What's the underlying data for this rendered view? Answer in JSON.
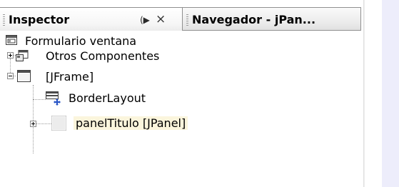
{
  "tabs": {
    "inspector": {
      "title": "Inspector",
      "minimize": "◀)",
      "close": "×"
    },
    "navegador": {
      "title": "Navegador - jPan..."
    }
  },
  "tree": {
    "root": "Formulario ventana",
    "otros": "Otros Componentes",
    "jframe": "[JFrame]",
    "layout": "BorderLayout",
    "panel": "panelTitulo [JPanel]"
  }
}
